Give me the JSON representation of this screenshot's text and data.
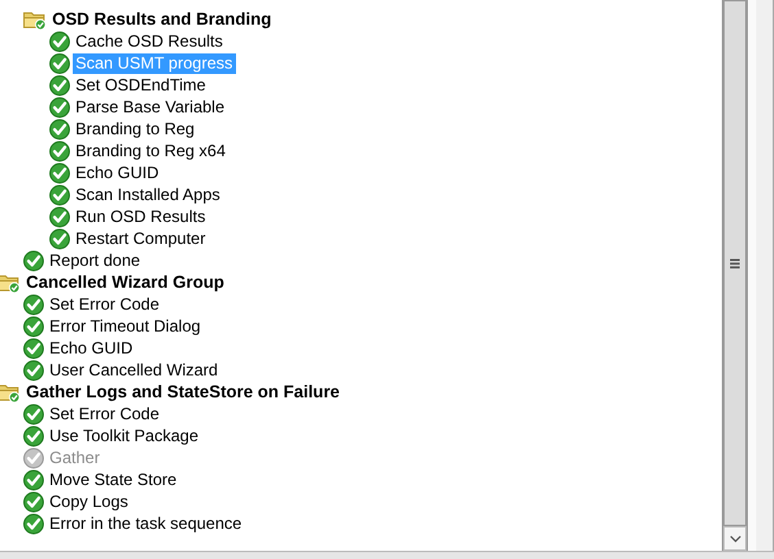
{
  "tree": {
    "items": [
      {
        "kind": "hidden",
        "children": [
          {
            "kind": "group",
            "label": "OSD Results and Branding",
            "disabled": false,
            "selected": false,
            "children": [
              {
                "kind": "step",
                "label": "Cache OSD Results",
                "disabled": false,
                "selected": false
              },
              {
                "kind": "step",
                "label": "Scan USMT progress",
                "disabled": false,
                "selected": true
              },
              {
                "kind": "step",
                "label": "Set OSDEndTime",
                "disabled": false,
                "selected": false
              },
              {
                "kind": "step",
                "label": "Parse Base Variable",
                "disabled": false,
                "selected": false
              },
              {
                "kind": "step",
                "label": "Branding to Reg",
                "disabled": false,
                "selected": false
              },
              {
                "kind": "step",
                "label": "Branding to Reg x64",
                "disabled": false,
                "selected": false
              },
              {
                "kind": "step",
                "label": "Echo GUID",
                "disabled": false,
                "selected": false
              },
              {
                "kind": "step",
                "label": "Scan Installed Apps",
                "disabled": false,
                "selected": false
              },
              {
                "kind": "step",
                "label": "Run OSD Results",
                "disabled": false,
                "selected": false
              },
              {
                "kind": "step",
                "label": "Restart Computer",
                "disabled": false,
                "selected": false
              }
            ]
          },
          {
            "kind": "step",
            "label": "Report done",
            "disabled": false,
            "selected": false
          }
        ]
      },
      {
        "kind": "group",
        "label": "Cancelled Wizard Group",
        "disabled": false,
        "selected": false,
        "children": [
          {
            "kind": "step",
            "label": "Set Error Code",
            "disabled": false,
            "selected": false
          },
          {
            "kind": "step",
            "label": "Error Timeout Dialog",
            "disabled": false,
            "selected": false
          },
          {
            "kind": "step",
            "label": "Echo GUID",
            "disabled": false,
            "selected": false
          },
          {
            "kind": "step",
            "label": "User Cancelled Wizard",
            "disabled": false,
            "selected": false
          }
        ]
      },
      {
        "kind": "group",
        "label": "Gather Logs and StateStore on Failure",
        "disabled": false,
        "selected": false,
        "children": [
          {
            "kind": "step",
            "label": "Set Error Code",
            "disabled": false,
            "selected": false
          },
          {
            "kind": "step",
            "label": "Use Toolkit Package",
            "disabled": false,
            "selected": false
          },
          {
            "kind": "step",
            "label": "Gather",
            "disabled": true,
            "selected": false
          },
          {
            "kind": "step",
            "label": "Move State Store",
            "disabled": false,
            "selected": false
          },
          {
            "kind": "step",
            "label": "Copy Logs",
            "disabled": false,
            "selected": false
          },
          {
            "kind": "step",
            "label": "Error in the task sequence",
            "disabled": false,
            "selected": false
          }
        ]
      }
    ]
  }
}
